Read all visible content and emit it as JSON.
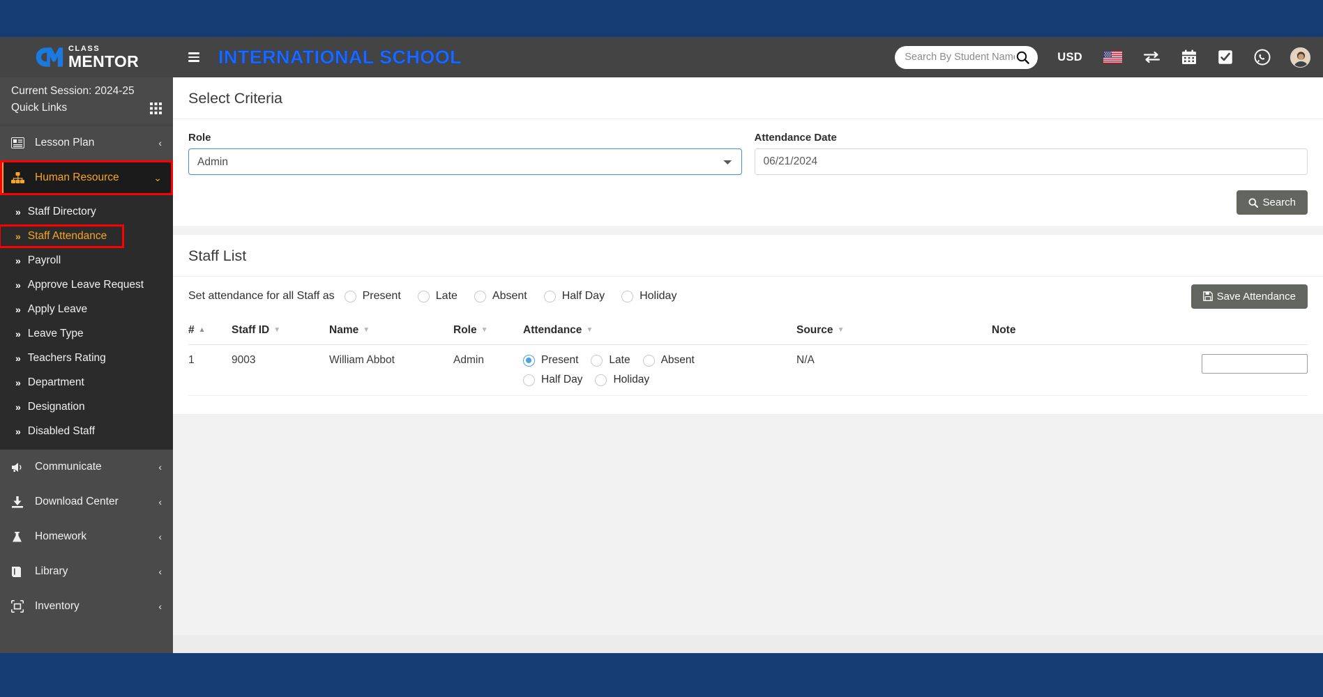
{
  "brand": {
    "line1": "CLASS",
    "line2": "MENTOR",
    "logo_icon": "cm-logo-icon"
  },
  "sidebar": {
    "session_label": "Current Session: 2024-25",
    "quick_links_label": "Quick Links",
    "quick_links_icon": "grid-icon",
    "items": [
      {
        "label": "Lesson Plan",
        "icon": "lesson-plan-icon",
        "caret": "‹",
        "active": false
      },
      {
        "label": "Human Resource",
        "icon": "sitemap-icon",
        "caret": "⌄",
        "active": true
      },
      {
        "label": "Communicate",
        "icon": "megaphone-icon",
        "caret": "‹",
        "active": false
      },
      {
        "label": "Download Center",
        "icon": "download-icon",
        "caret": "‹",
        "active": false
      },
      {
        "label": "Homework",
        "icon": "flask-icon",
        "caret": "‹",
        "active": false
      },
      {
        "label": "Library",
        "icon": "book-icon",
        "caret": "‹",
        "active": false
      },
      {
        "label": "Inventory",
        "icon": "inventory-icon",
        "caret": "‹",
        "active": false
      }
    ],
    "submenu": [
      {
        "label": "Staff Directory",
        "highlighted": false
      },
      {
        "label": "Staff Attendance",
        "highlighted": true
      },
      {
        "label": "Payroll",
        "highlighted": false
      },
      {
        "label": "Approve Leave Request",
        "highlighted": false
      },
      {
        "label": "Apply Leave",
        "highlighted": false
      },
      {
        "label": "Leave Type",
        "highlighted": false
      },
      {
        "label": "Teachers Rating",
        "highlighted": false
      },
      {
        "label": "Department",
        "highlighted": false
      },
      {
        "label": "Designation",
        "highlighted": false
      },
      {
        "label": "Disabled Staff",
        "highlighted": false
      }
    ]
  },
  "topbar": {
    "menu_toggle_icon": "hamburger-icon",
    "school_name": "INTERNATIONAL SCHOOL",
    "search_placeholder": "Search By Student Name...",
    "search_value": "",
    "search_icon": "search-icon",
    "currency": "USD",
    "flag_icon": "us-flag-icon",
    "exchange_icon": "exchange-arrows-icon",
    "calendar_icon": "calendar-icon",
    "checkbox_icon": "checkbox-check-icon",
    "whatsapp_icon": "whatsapp-icon",
    "avatar_icon": "user-avatar"
  },
  "criteria": {
    "title": "Select Criteria",
    "role_label": "Role",
    "role_value": "Admin",
    "role_options": [
      "Admin"
    ],
    "date_label": "Attendance Date",
    "date_value": "06/21/2024",
    "search_label": "Search",
    "search_icon": "search-icon"
  },
  "staff_list": {
    "title": "Staff List",
    "set_all_label": "Set attendance for all Staff as",
    "set_all_options": [
      {
        "label": "Present",
        "checked": false
      },
      {
        "label": "Late",
        "checked": false
      },
      {
        "label": "Absent",
        "checked": false
      },
      {
        "label": "Half Day",
        "checked": false
      },
      {
        "label": "Holiday",
        "checked": false
      }
    ],
    "save_label": "Save Attendance",
    "save_icon": "save-floppy-icon",
    "columns": [
      {
        "label": "#",
        "sort": "asc"
      },
      {
        "label": "Staff ID",
        "sort": "none"
      },
      {
        "label": "Name",
        "sort": "none"
      },
      {
        "label": "Role",
        "sort": "none"
      },
      {
        "label": "Attendance",
        "sort": "none"
      },
      {
        "label": "Source",
        "sort": "none"
      },
      {
        "label": "Note",
        "sort": null
      }
    ],
    "rows": [
      {
        "num": "1",
        "staff_id": "9003",
        "name": "William Abbot",
        "role": "Admin",
        "attendance": [
          {
            "label": "Present",
            "checked": true
          },
          {
            "label": "Late",
            "checked": false
          },
          {
            "label": "Absent",
            "checked": false
          },
          {
            "label": "Half Day",
            "checked": false
          },
          {
            "label": "Holiday",
            "checked": false
          }
        ],
        "source": "N/A",
        "note": ""
      }
    ]
  },
  "colors": {
    "page_navy": "#163c74",
    "sidebar": "#4a4a4a",
    "submenu": "#2b2b2b",
    "accent_orange": "#f5a623",
    "highlight_red": "#ff0000",
    "school_blue": "#1b69ff",
    "radio_blue": "#4aa3df",
    "button_gray": "#63655f"
  }
}
